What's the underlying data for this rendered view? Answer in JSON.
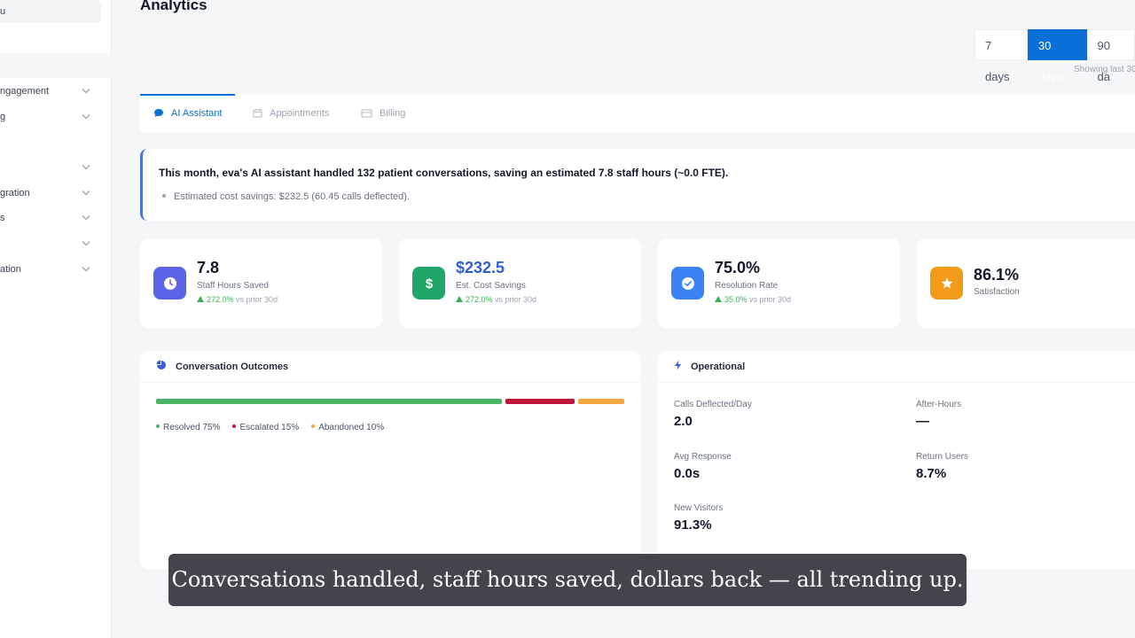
{
  "sidebar": {
    "top_label": "u",
    "items": [
      {
        "label": "ngagement"
      },
      {
        "label": "g"
      },
      {
        "label": ""
      },
      {
        "label": "gration"
      },
      {
        "label": "s"
      },
      {
        "label": ""
      },
      {
        "label": "ation"
      }
    ]
  },
  "header": {
    "title": "Analytics",
    "ranges": [
      "7 days",
      "30 days",
      "90 da"
    ],
    "active_range": "30 days",
    "showing": "Showing last 30"
  },
  "tabs": [
    {
      "label": "AI Assistant",
      "icon": "chat-icon",
      "active": true
    },
    {
      "label": "Appointments",
      "icon": "calendar-icon",
      "active": false
    },
    {
      "label": "Billing",
      "icon": "card-icon",
      "active": false
    }
  ],
  "summary": {
    "headline": "This month, eva's AI assistant handled 132 patient conversations, saving an estimated 7.8 staff hours (~0.0 FTE).",
    "bullet": "Estimated cost savings: $232.5 (60.45 calls deflected)."
  },
  "kpis": [
    {
      "value": "7.8",
      "label": "Staff Hours Saved",
      "trend_pct": "272.0%",
      "trend_suffix": " vs prior 30d",
      "icon": "clock-icon",
      "color": "#5b63e6"
    },
    {
      "value": "$232.5",
      "label": "Est. Cost Savings",
      "trend_pct": "272.0%",
      "trend_suffix": " vs prior 30d",
      "icon": "dollar-icon",
      "color": "#1fa76a"
    },
    {
      "value": "75.0%",
      "label": "Resolution Rate",
      "trend_pct": "35.0%",
      "trend_suffix": " vs prior 30d",
      "icon": "check-icon",
      "color": "#3b82f6"
    },
    {
      "value": "86.1%",
      "label": "Satisfaction",
      "icon": "star-icon",
      "color": "#f29a1a"
    }
  ],
  "outcomes": {
    "title": "Conversation Outcomes",
    "segments": [
      {
        "name": "Resolved",
        "pct_label": "Resolved 75%",
        "value": 75,
        "color": "#4bb464"
      },
      {
        "name": "Escalated",
        "pct_label": "Escalated 15%",
        "value": 15,
        "color": "#c0163c"
      },
      {
        "name": "Abandoned",
        "pct_label": "Abandoned 10%",
        "value": 10,
        "color": "#f5a63f"
      }
    ]
  },
  "operational": {
    "title": "Operational",
    "metrics": [
      {
        "label": "Calls Deflected/Day",
        "value": "2.0"
      },
      {
        "label": "After-Hours",
        "value": "—"
      },
      {
        "label": "Avg Response",
        "value": "0.0s"
      },
      {
        "label": "Return Users",
        "value": "8.7%"
      },
      {
        "label": "New Visitors",
        "value": "91.3%"
      }
    ]
  },
  "caption": "Conversations handled, staff hours saved, dollars back — all trending up."
}
